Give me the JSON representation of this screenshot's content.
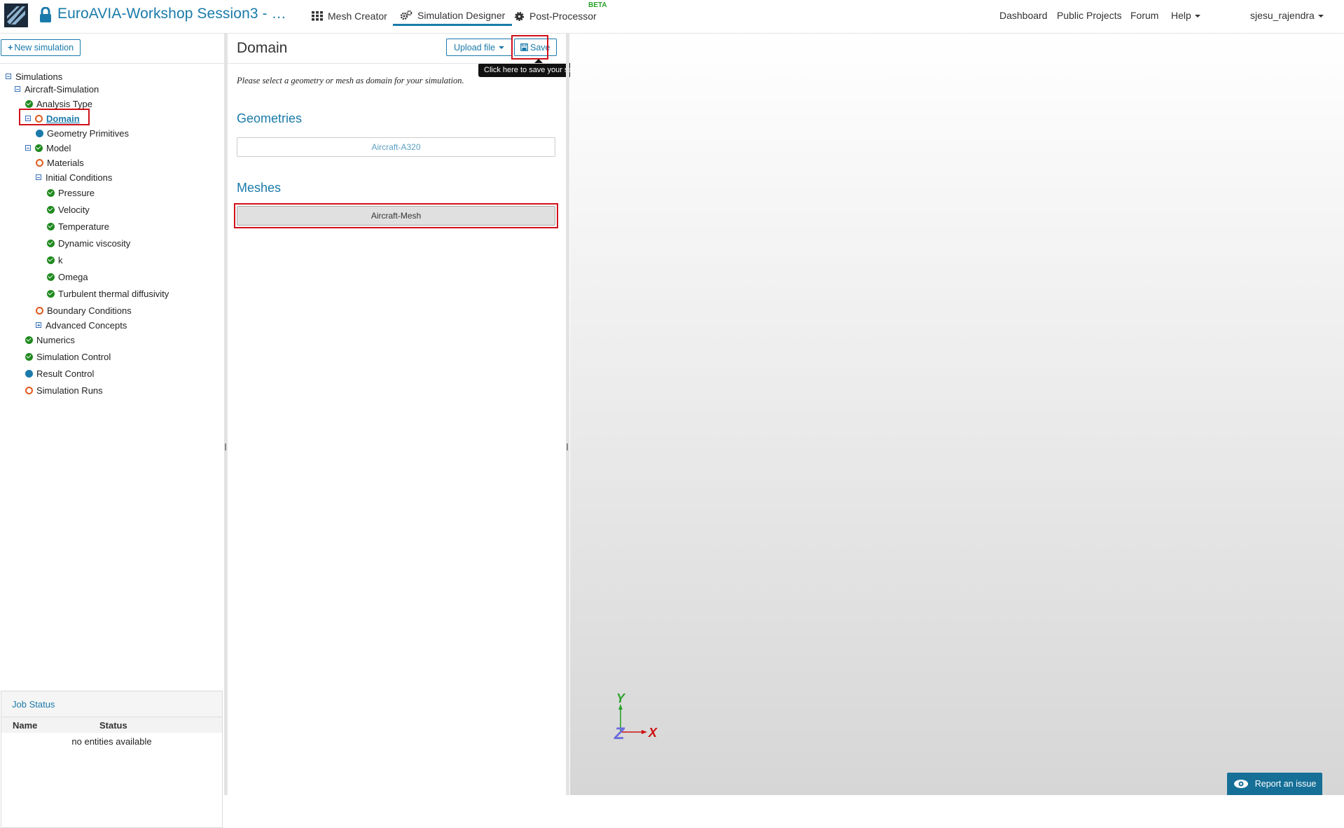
{
  "header": {
    "project_title": "EuroAVIA-Workshop Session3 - …",
    "tabs": [
      {
        "label": "Mesh Creator"
      },
      {
        "label": "Simulation Designer"
      },
      {
        "label": "Post-Processor",
        "badge": "BETA"
      }
    ],
    "links": [
      "Dashboard",
      "Public Projects",
      "Forum",
      "Help"
    ],
    "user": "sjesu_rajendra"
  },
  "sidebar": {
    "new_simulation": "New simulation",
    "tree": [
      {
        "label": "Simulations",
        "toggle": "minus",
        "status": "none"
      },
      {
        "label": "Aircraft-Simulation",
        "toggle": "minus",
        "status": "none"
      },
      {
        "label": "Analysis Type",
        "toggle": "none",
        "status": "ok"
      },
      {
        "label": "Domain",
        "toggle": "minus",
        "status": "todo"
      },
      {
        "label": "Geometry Primitives",
        "toggle": "none",
        "status": "info"
      },
      {
        "label": "Model",
        "toggle": "minus",
        "status": "ok"
      },
      {
        "label": "Materials",
        "toggle": "none",
        "status": "todo"
      },
      {
        "label": "Initial Conditions",
        "toggle": "minus",
        "status": "none"
      },
      {
        "label": "Pressure",
        "toggle": "none",
        "status": "ok"
      },
      {
        "label": "Velocity",
        "toggle": "none",
        "status": "ok"
      },
      {
        "label": "Temperature",
        "toggle": "none",
        "status": "ok"
      },
      {
        "label": "Dynamic viscosity",
        "toggle": "none",
        "status": "ok"
      },
      {
        "label": "k",
        "toggle": "none",
        "status": "ok"
      },
      {
        "label": "Omega",
        "toggle": "none",
        "status": "ok"
      },
      {
        "label": "Turbulent thermal diffusivity",
        "toggle": "none",
        "status": "ok"
      },
      {
        "label": "Boundary Conditions",
        "toggle": "none",
        "status": "todo"
      },
      {
        "label": "Advanced Concepts",
        "toggle": "plus",
        "status": "none"
      },
      {
        "label": "Numerics",
        "toggle": "none",
        "status": "ok"
      },
      {
        "label": "Simulation Control",
        "toggle": "none",
        "status": "ok"
      },
      {
        "label": "Result Control",
        "toggle": "none",
        "status": "info"
      },
      {
        "label": "Simulation Runs",
        "toggle": "none",
        "status": "todo"
      }
    ],
    "job_status": {
      "title": "Job Status",
      "columns": [
        "Name",
        "Status"
      ],
      "empty": "no entities available"
    }
  },
  "main": {
    "title": "Domain",
    "upload": "Upload file",
    "save": "Save",
    "tooltip": "Click here to save your settings",
    "instruction": "Please select a geometry or mesh as domain for your simulation.",
    "geometries_title": "Geometries",
    "geometries": [
      "Aircraft-A320"
    ],
    "meshes_title": "Meshes",
    "meshes": [
      "Aircraft-Mesh"
    ]
  },
  "viewer": {
    "axes": {
      "x": "X",
      "y": "Y",
      "z": "Z"
    },
    "report": "Report an issue"
  },
  "colors": {
    "accent": "#1a7aaa",
    "ok": "#1f8a1f",
    "todo": "#e05a1e",
    "highlight": "#d0101a"
  }
}
